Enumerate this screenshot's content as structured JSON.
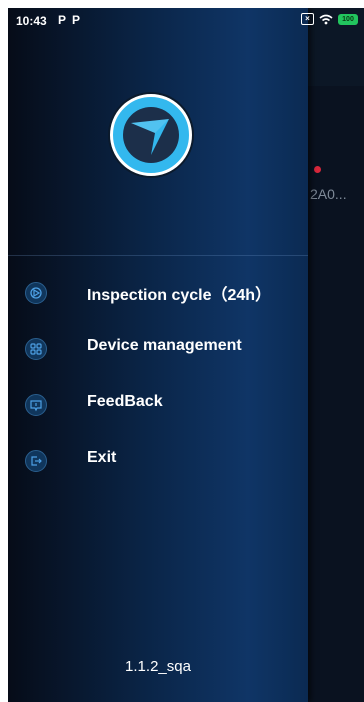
{
  "status_bar": {
    "time": "10:43",
    "notif_1": "P",
    "notif_2": "P",
    "battery": "100"
  },
  "background_page": {
    "device_text": "2A0..."
  },
  "drawer": {
    "logo": "app-logo",
    "menu": [
      {
        "label": "Inspection cycle（24h）",
        "icon": "inspection-cycle-icon"
      },
      {
        "label": "Device management",
        "icon": "device-management-icon"
      },
      {
        "label": "FeedBack",
        "icon": "feedback-icon"
      },
      {
        "label": "Exit",
        "icon": "exit-icon"
      }
    ],
    "version": "1.1.2_sqa"
  },
  "colors": {
    "logo_blue": "#33b8ee",
    "drawer_dark": "#060c18",
    "drawer_blue": "#0f3566",
    "battery_green": "#22c55e",
    "alert_red": "#d8283c"
  }
}
